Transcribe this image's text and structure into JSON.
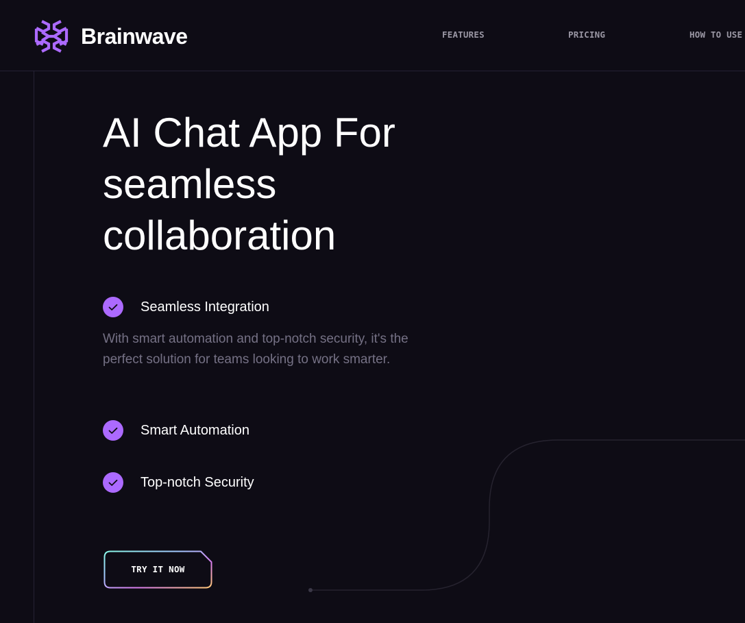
{
  "brand": {
    "name": "Brainwave",
    "logo_icon": "brainwave-logo-icon",
    "color": "#ac6aff"
  },
  "nav": {
    "items": [
      {
        "label": "FEATURES"
      },
      {
        "label": "PRICING"
      },
      {
        "label": "HOW TO USE"
      }
    ]
  },
  "hero": {
    "title": "AI Chat App For seamless collaboration",
    "features": [
      {
        "label": "Seamless Integration",
        "icon": "check-icon"
      },
      {
        "label": "Smart Automation",
        "icon": "check-icon"
      },
      {
        "label": "Top-notch Security",
        "icon": "check-icon"
      }
    ],
    "description": "With smart automation and top-notch security, it's the perfect solution for teams looking to work smarter.",
    "cta_label": "TRY IT NOW"
  },
  "colors": {
    "background": "#0e0c15",
    "accent": "#ac6aff",
    "muted_text": "#757185",
    "border": "#252134"
  }
}
